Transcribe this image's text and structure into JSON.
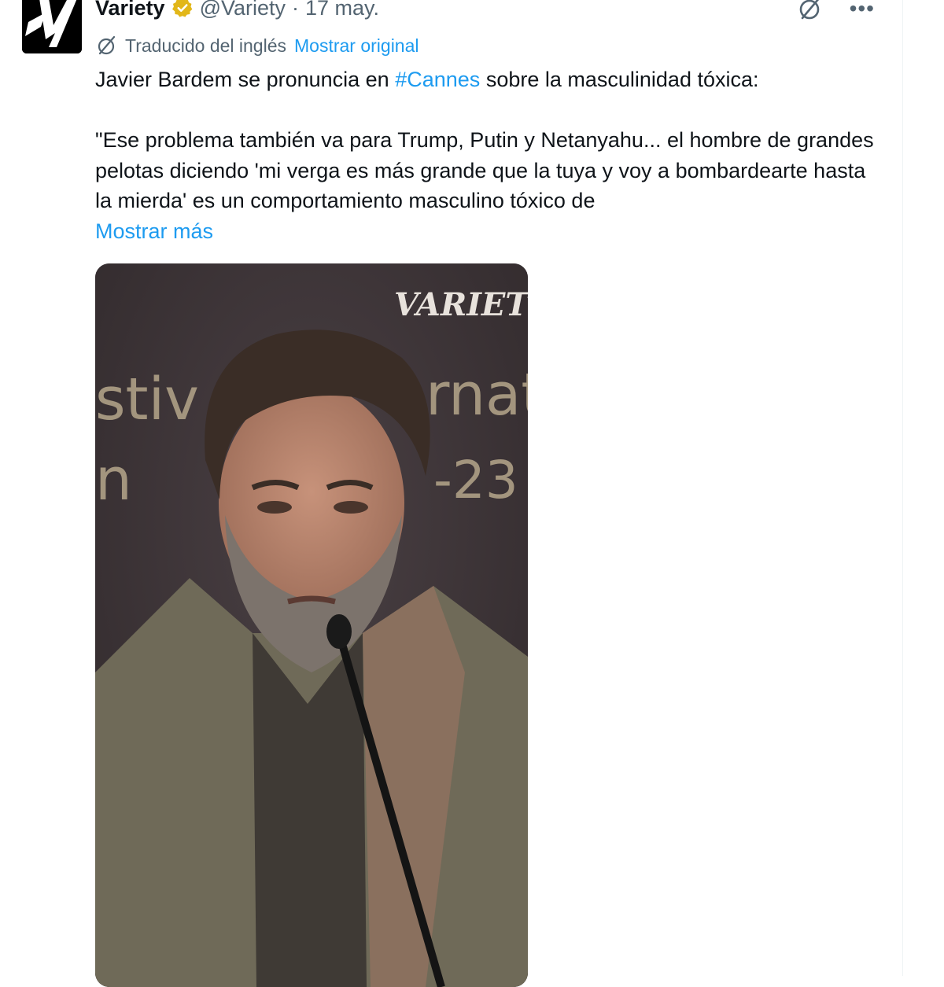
{
  "tweet": {
    "author_name": "Variety",
    "handle": "@Variety",
    "separator": "·",
    "date": "17 may.",
    "translation_note": "Traducido del inglés",
    "show_original": "Mostrar original",
    "text_before_hashtag": "Javier Bardem se pronuncia en ",
    "hashtag": "#Cannes",
    "text_after_hashtag": " sobre la masculinidad tóxica:",
    "quote": "\"Ese problema también va para Trump, Putin y Netanyahu... el hombre de grandes pelotas diciendo 'mi verga es más grande que la tuya y voy a bombardearte hasta la mierda' es un comportamiento masculino tóxico de",
    "show_more": "Mostrar más"
  },
  "media": {
    "watermark": "VARIETY",
    "backdrop_text_1": "stiv",
    "backdrop_text_2": "rnat",
    "backdrop_text_3": "n",
    "backdrop_text_4": "-23"
  },
  "icons": {
    "verified": "verified-badge-icon",
    "grok": "grok-icon",
    "more": "more-icon",
    "translate": "translate-icon"
  },
  "colors": {
    "link": "#1d9bf0",
    "secondary_text": "#536471",
    "verified_gold": "#e2b719"
  }
}
